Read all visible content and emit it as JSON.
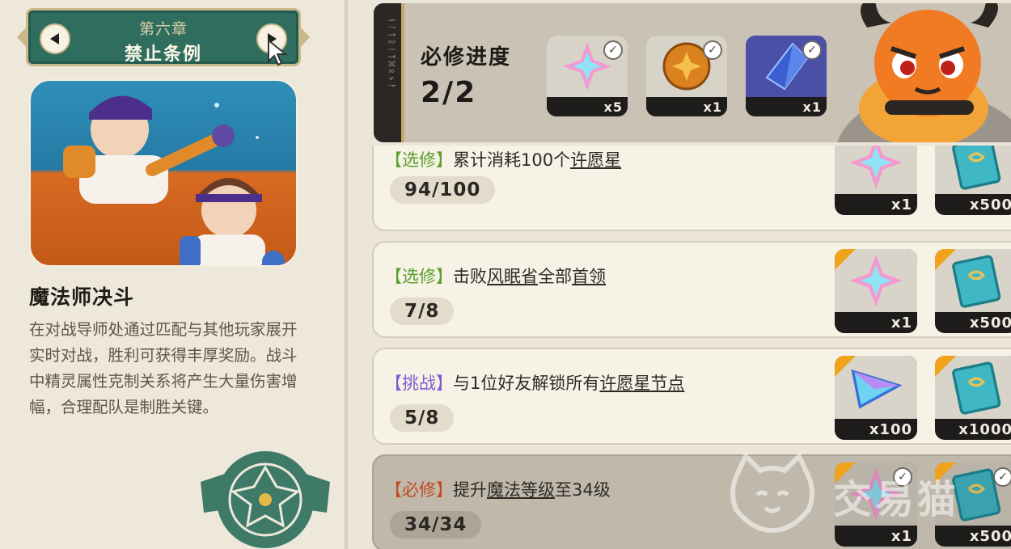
{
  "chapter": {
    "subtitle": "第六章",
    "title": "禁止条例"
  },
  "mode": {
    "title": "魔法师决斗",
    "description": "在对战导师处通过匹配与其他玩家展开实时对战，胜利可获得丰厚奖励。战斗中精灵属性克制关系将产生大量伤害增幅，合理配队是制胜关键。"
  },
  "progress": {
    "label": "必修进度",
    "value": "2/2",
    "rewards": [
      {
        "icon": "wish-star-icon",
        "qty": "x5",
        "claimed": true
      },
      {
        "icon": "orange-coin-icon",
        "qty": "x1",
        "claimed": true
      },
      {
        "icon": "blue-crystal-icon",
        "qty": "x1",
        "claimed": true
      }
    ]
  },
  "tasks": [
    {
      "tag": "【选修】",
      "tag_color": "green",
      "text_a": "累计消耗100个",
      "text_u": "许愿星",
      "text_b": "",
      "count": "94/100",
      "rewards": [
        {
          "icon": "wish-star-icon",
          "qty": "x1"
        },
        {
          "icon": "spellbook-icon",
          "qty": "x500"
        }
      ],
      "done": false
    },
    {
      "tag": "【选修】",
      "tag_color": "green",
      "text_a": "击败",
      "text_u": "风眠省",
      "text_b": "全部",
      "text_u2": "首领",
      "count": "7/8",
      "rewards": [
        {
          "icon": "wish-star-icon",
          "qty": "x1"
        },
        {
          "icon": "spellbook-icon",
          "qty": "x500"
        }
      ],
      "done": false
    },
    {
      "tag": "【挑战】",
      "tag_color": "purple",
      "text_a": "与1位好友解锁所有",
      "text_u": "许愿星节点",
      "text_b": "",
      "count": "5/8",
      "rewards": [
        {
          "icon": "prism-crystal-icon",
          "qty": "x100"
        },
        {
          "icon": "spellbook-icon",
          "qty": "x1000"
        }
      ],
      "done": false
    },
    {
      "tag": "【必修】",
      "tag_color": "orange",
      "text_a": "提升",
      "text_u": "魔法等级",
      "text_b": "至34级",
      "count": "34/34",
      "rewards": [
        {
          "icon": "wish-star-icon",
          "qty": "x1"
        },
        {
          "icon": "spellbook-icon",
          "qty": "x500"
        }
      ],
      "done": true
    }
  ],
  "rune_strip_text": "ᚾᛚᛏᚱᛁᛉᛞᛟᛃᚨ",
  "watermark": "交易猫",
  "colors": {
    "banner_green": "#2f6e5f",
    "tag_green": "#5aa02c",
    "tag_purple": "#7c5bd0",
    "tag_orange": "#c2491b",
    "corner_gold": "#f0a21a"
  }
}
